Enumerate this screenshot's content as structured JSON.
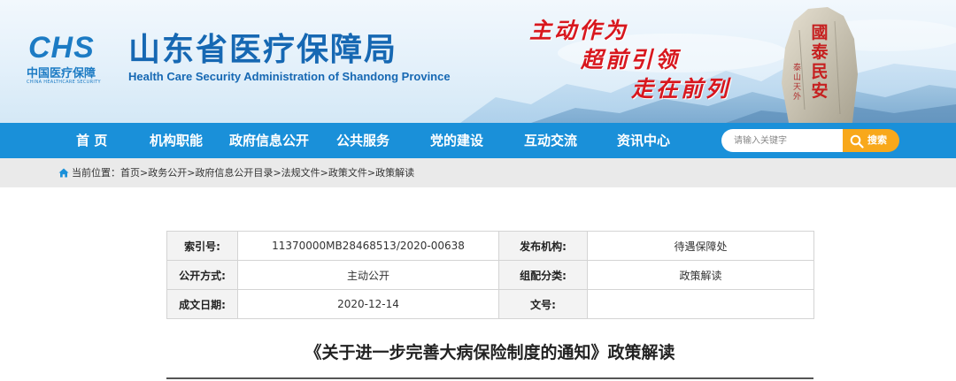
{
  "header": {
    "logo_mark": "CHS",
    "logo_cn": "中国医疗保障",
    "logo_en": "CHINA HEALTHCARE SECURITY",
    "title_cn": "山东省医疗保障局",
    "title_en": "Health Care Security Administration of Shandong Province",
    "slogans": [
      "主动作为",
      "超前引领",
      "走在前列"
    ],
    "rock_inscription": "國泰民安",
    "rock_sub": "泰山天外"
  },
  "nav": {
    "items": [
      {
        "label": "首 页"
      },
      {
        "label": "机构职能"
      },
      {
        "label": "政府信息公开"
      },
      {
        "label": "公共服务"
      },
      {
        "label": "党的建设"
      },
      {
        "label": "互动交流"
      },
      {
        "label": "资讯中心"
      }
    ],
    "search_placeholder": "请输入关键字",
    "search_button": "搜索"
  },
  "breadcrumb": {
    "label": "当前位置：",
    "items": [
      "首页",
      "政务公开",
      "政府信息公开目录",
      "法规文件",
      "政策文件",
      "政策解读"
    ],
    "separator": ">"
  },
  "info_table": {
    "rows": [
      [
        {
          "key": "索引号:",
          "value": "11370000MB28468513/2020-00638"
        },
        {
          "key": "发布机构:",
          "value": "待遇保障处"
        }
      ],
      [
        {
          "key": "公开方式:",
          "value": "主动公开"
        },
        {
          "key": "组配分类:",
          "value": "政策解读"
        }
      ],
      [
        {
          "key": "成文日期:",
          "value": "2020-12-14"
        },
        {
          "key": "文号:",
          "value": ""
        }
      ]
    ]
  },
  "article": {
    "title": "《关于进一步完善大病保险制度的通知》政策解读"
  },
  "colors": {
    "brand_blue": "#1668b3",
    "nav_blue": "#1a90d9",
    "slogan_red": "#d8171e",
    "search_orange": "#f8a81b",
    "crumb_gray": "#eaeaea"
  }
}
